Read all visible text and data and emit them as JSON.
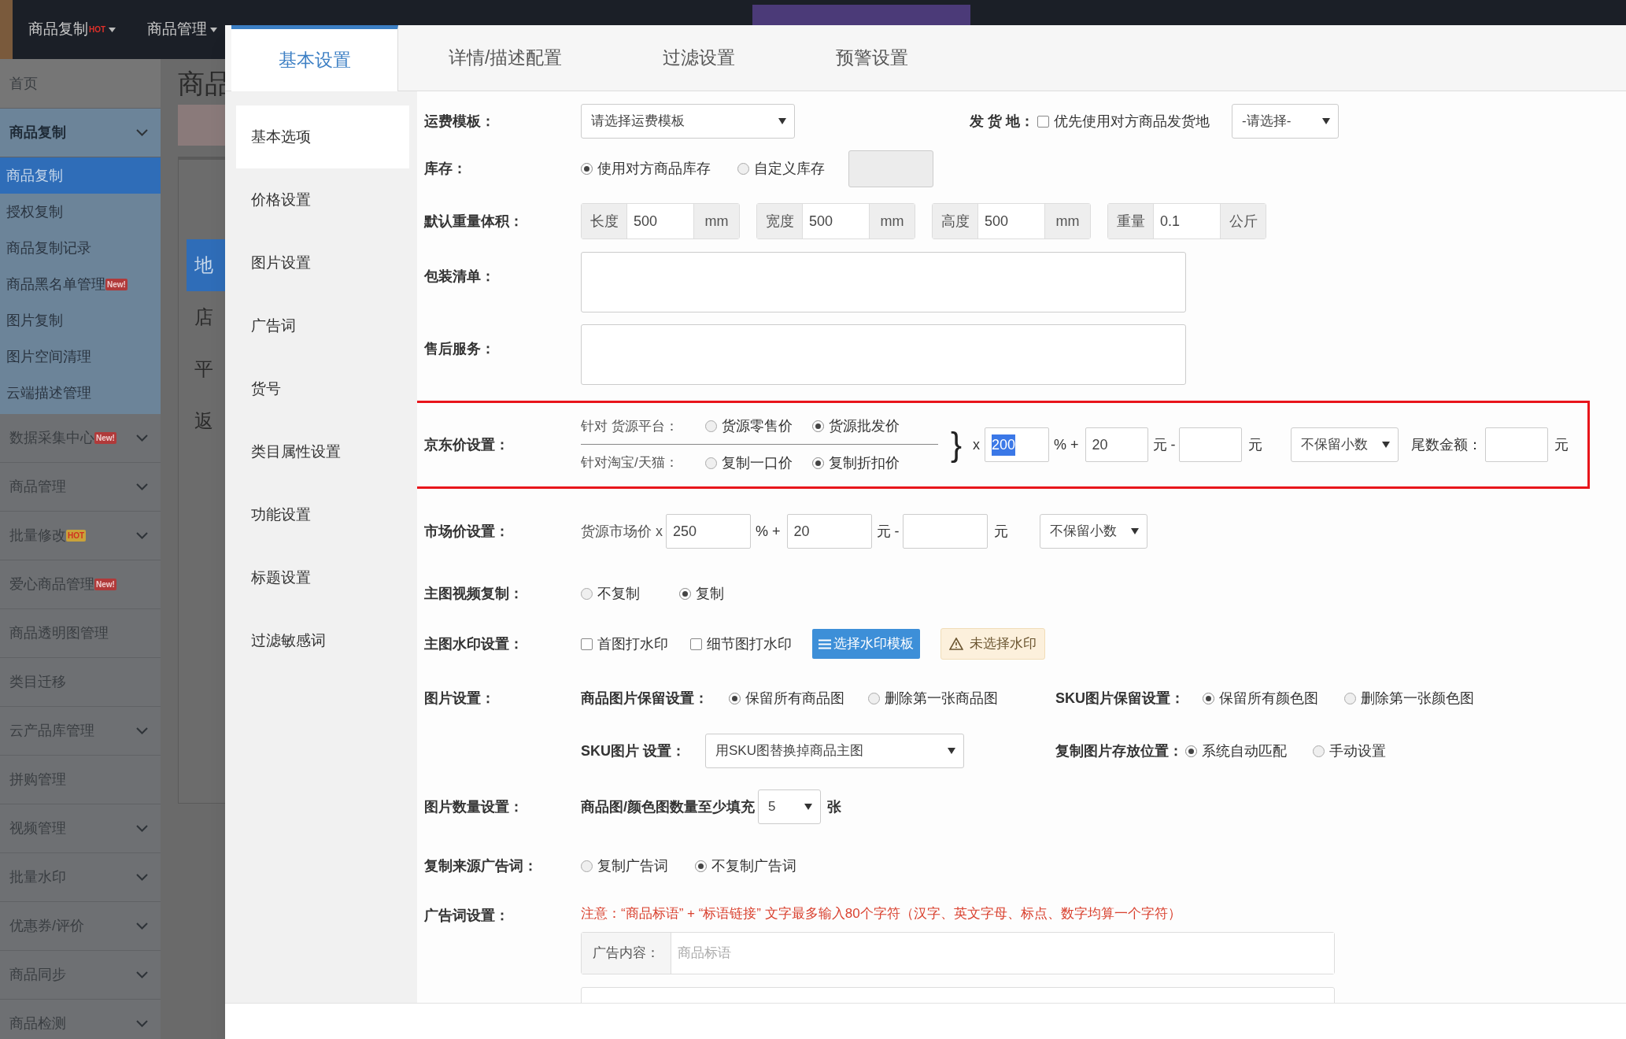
{
  "top_nav": [
    {
      "label": "商品复制",
      "badge": "HOT"
    },
    {
      "label": "商品管理"
    }
  ],
  "sidebar": {
    "items": [
      {
        "label": "首页"
      },
      {
        "label": "商品复制",
        "expanded": true,
        "children": [
          {
            "label": "商品复制",
            "selected": true
          },
          {
            "label": "授权复制",
            "selected": false
          },
          {
            "label": "商品复制记录",
            "selected": false
          },
          {
            "label": "商品黑名单管理",
            "badge": "New!",
            "selected": false
          },
          {
            "label": "图片复制",
            "selected": false
          },
          {
            "label": "图片空间清理",
            "selected": false
          },
          {
            "label": "云端描述管理",
            "selected": false
          }
        ]
      },
      {
        "label": "数据采集中心",
        "badge": "New!",
        "expanded": false
      },
      {
        "label": "商品管理",
        "expanded": false
      },
      {
        "label": "批量修改",
        "badge": "HOT",
        "expanded": false
      },
      {
        "label": "爱心商品管理",
        "badge": "New!"
      },
      {
        "label": "商品透明图管理"
      },
      {
        "label": "类目迁移"
      },
      {
        "label": "云产品库管理",
        "expanded": false
      },
      {
        "label": "拼购管理"
      },
      {
        "label": "视频管理",
        "expanded": false
      },
      {
        "label": "批量水印",
        "expanded": false
      },
      {
        "label": "优惠券/评价",
        "expanded": false
      },
      {
        "label": "商品同步",
        "expanded": false
      },
      {
        "label": "商品检测",
        "expanded": false
      }
    ]
  },
  "background_page": {
    "heading": "商品",
    "tabs": [
      {
        "label": "地",
        "selected": true
      },
      {
        "label": "店",
        "selected": false
      },
      {
        "label": "平",
        "selected": false
      },
      {
        "label": "返",
        "selected": false
      }
    ]
  },
  "modal": {
    "tabs": [
      {
        "label": "基本设置",
        "selected": true
      },
      {
        "label": "详情/描述配置",
        "selected": false
      },
      {
        "label": "过滤设置",
        "selected": false
      },
      {
        "label": "预警设置",
        "selected": false
      }
    ],
    "side_menu": [
      {
        "label": "基本选项",
        "selected": true
      },
      {
        "label": "价格设置",
        "selected": false
      },
      {
        "label": "图片设置",
        "selected": false
      },
      {
        "label": "广告词",
        "selected": false
      },
      {
        "label": "货号",
        "selected": false
      },
      {
        "label": "类目属性设置",
        "selected": false
      },
      {
        "label": "功能设置",
        "selected": false
      },
      {
        "label": "标题设置",
        "selected": false
      },
      {
        "label": "过滤敏感词",
        "selected": false
      }
    ],
    "form": [
      {
        "kind": "shipping",
        "label": "运费模板：",
        "select": "请选择运费模板",
        "origin_label": "发 货 地：",
        "origin_checkbox": {
          "label": "优先使用对方商品发货地",
          "checked": false
        },
        "origin_select": "-请选择-"
      },
      {
        "kind": "stock",
        "label": "库存：",
        "options": [
          {
            "label": "使用对方商品库存",
            "selected": true
          },
          {
            "label": "自定义库存",
            "selected": false
          }
        ],
        "custom_field": {
          "disabled": true
        }
      },
      {
        "kind": "dims",
        "label": "默认重量体积：",
        "groups": [
          {
            "prefix": "长度",
            "value": "500",
            "unit": "mm"
          },
          {
            "prefix": "宽度",
            "value": "500",
            "unit": "mm"
          },
          {
            "prefix": "高度",
            "value": "500",
            "unit": "mm"
          },
          {
            "prefix": "重量",
            "value": "0.1",
            "unit": "公斤"
          }
        ]
      },
      {
        "kind": "textarea",
        "label": "包装清单："
      },
      {
        "kind": "textarea",
        "label": "售后服务："
      },
      {
        "kind": "jd_price",
        "label": "京东价设置：",
        "highlighted": true,
        "sources": [
          {
            "label": "针对 货源平台：",
            "options": [
              {
                "label": "货源零售价",
                "selected": false
              },
              {
                "label": "货源批发价",
                "selected": true
              }
            ]
          },
          {
            "label": "针对淘宝/天猫：",
            "options": [
              {
                "label": "复制一口价",
                "selected": false
              },
              {
                "label": "复制折扣价",
                "selected": true
              }
            ]
          }
        ],
        "brace": "}",
        "multiply": "x",
        "percent": {
          "value": "200",
          "text_selected": true
        },
        "percent_sign": "% +",
        "add_value": "20",
        "yuan_minus": "元 -",
        "yuan": "元",
        "rounding": "不保留小数",
        "tail_label": "尾数金额：",
        "tail_unit": "元"
      },
      {
        "kind": "market_price",
        "label": "市场价设置：",
        "prefix": "货源市场价 x",
        "percent": {
          "value": "250",
          "text_selected": false
        },
        "percent_sign": "% +",
        "add_value": "20",
        "yuan_minus": "元 -",
        "yuan": "元",
        "rounding": "不保留小数"
      },
      {
        "kind": "radios",
        "label": "主图视频复制：",
        "options": [
          {
            "label": "不复制",
            "selected": false
          },
          {
            "label": "复制",
            "selected": true
          }
        ]
      },
      {
        "kind": "watermark",
        "label": "主图水印设置：",
        "checkboxes": [
          {
            "label": "首图打水印",
            "checked": false
          },
          {
            "label": "细节图打水印",
            "checked": false
          }
        ],
        "button": "选择水印模板",
        "warning": "未选择水印"
      },
      {
        "kind": "images",
        "label": "图片设置：",
        "groups": [
          {
            "label": "商品图片保留设置：",
            "options": [
              {
                "label": "保留所有商品图",
                "selected": true
              },
              {
                "label": "删除第一张商品图",
                "selected": false
              }
            ]
          },
          {
            "label": "SKU图片保留设置：",
            "options": [
              {
                "label": "保留所有颜色图",
                "selected": true
              },
              {
                "label": "删除第一张颜色图",
                "selected": false
              }
            ]
          }
        ],
        "sku_label": "SKU图片 设置：",
        "sku_select": "用SKU图替换掉商品主图",
        "storage_label": "复制图片存放位置：",
        "storage_options": [
          {
            "label": "系统自动匹配",
            "selected": true
          },
          {
            "label": "手动设置",
            "selected": false
          }
        ]
      },
      {
        "kind": "count",
        "label": "图片数量设置：",
        "text": "商品图/颜色图数量至少填充",
        "select": "5",
        "unit": "张"
      },
      {
        "kind": "radios",
        "label": "复制来源广告词：",
        "options": [
          {
            "label": "复制广告词",
            "selected": false
          },
          {
            "label": "不复制广告词",
            "selected": true
          }
        ]
      },
      {
        "kind": "slogan",
        "label": "广告词设置：",
        "notice": "注意：“商品标语” + “标语链接” 文字最多输入80个字符（汉字、英文字母、标点、数字均算一个字符）",
        "prefix": "广告内容：",
        "placeholder": "商品标语"
      }
    ]
  }
}
